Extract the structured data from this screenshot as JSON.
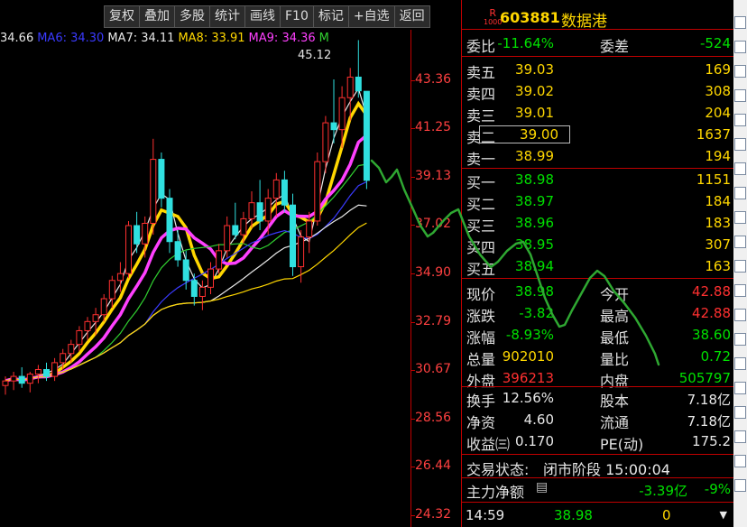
{
  "toolbar": {
    "buttons": [
      "复权",
      "叠加",
      "多股",
      "统计",
      "画线",
      "F10",
      "标记",
      "+自选",
      "返回"
    ]
  },
  "ma_legend": [
    {
      "label": "34.66",
      "color": "#e8e8e8"
    },
    {
      "label": "MA6: 34.30",
      "color": "#3a3aff"
    },
    {
      "label": "MA7: 34.11",
      "color": "#e8e8e8"
    },
    {
      "label": "MA8: 33.91",
      "color": "#ffd700"
    },
    {
      "label": "MA9: 34.36",
      "color": "#ff40ff"
    },
    {
      "label": "M",
      "color": "#30d030"
    }
  ],
  "peak_label": "45.12",
  "chart_data": {
    "type": "candlestick",
    "price_axis_ticks": [
      "43.36",
      "41.25",
      "39.13",
      "37.02",
      "34.90",
      "32.79",
      "30.67",
      "28.56",
      "26.44",
      "24.32"
    ],
    "ylim": [
      24.32,
      43.36
    ],
    "candles": [
      {
        "o": 30.0,
        "h": 30.4,
        "l": 29.6,
        "c": 30.2
      },
      {
        "o": 30.2,
        "h": 30.6,
        "l": 29.8,
        "c": 30.4
      },
      {
        "o": 30.4,
        "h": 30.8,
        "l": 29.9,
        "c": 30.1
      },
      {
        "o": 30.1,
        "h": 30.6,
        "l": 29.7,
        "c": 30.5
      },
      {
        "o": 30.5,
        "h": 30.9,
        "l": 30.1,
        "c": 30.7
      },
      {
        "o": 30.7,
        "h": 31.0,
        "l": 30.2,
        "c": 30.4
      },
      {
        "o": 30.4,
        "h": 31.2,
        "l": 30.2,
        "c": 31.0
      },
      {
        "o": 31.0,
        "h": 31.6,
        "l": 30.7,
        "c": 31.4
      },
      {
        "o": 31.4,
        "h": 32.0,
        "l": 31.0,
        "c": 31.8
      },
      {
        "o": 31.8,
        "h": 32.6,
        "l": 31.5,
        "c": 32.4
      },
      {
        "o": 32.4,
        "h": 33.0,
        "l": 32.0,
        "c": 32.8
      },
      {
        "o": 32.8,
        "h": 33.4,
        "l": 32.2,
        "c": 33.1
      },
      {
        "o": 33.1,
        "h": 34.0,
        "l": 32.8,
        "c": 33.8
      },
      {
        "o": 33.8,
        "h": 34.8,
        "l": 33.4,
        "c": 34.6
      },
      {
        "o": 34.6,
        "h": 35.4,
        "l": 34.1,
        "c": 34.9
      },
      {
        "o": 34.9,
        "h": 37.2,
        "l": 34.7,
        "c": 37.0
      },
      {
        "o": 37.0,
        "h": 37.6,
        "l": 35.8,
        "c": 36.2
      },
      {
        "o": 36.2,
        "h": 37.4,
        "l": 35.6,
        "c": 37.1
      },
      {
        "o": 37.1,
        "h": 40.8,
        "l": 36.6,
        "c": 39.9
      },
      {
        "o": 39.9,
        "h": 40.2,
        "l": 37.8,
        "c": 38.2
      },
      {
        "o": 38.2,
        "h": 38.6,
        "l": 35.8,
        "c": 36.3
      },
      {
        "o": 36.3,
        "h": 36.8,
        "l": 35.2,
        "c": 35.5
      },
      {
        "o": 35.5,
        "h": 35.9,
        "l": 34.2,
        "c": 34.6
      },
      {
        "o": 34.6,
        "h": 34.9,
        "l": 33.5,
        "c": 33.9
      },
      {
        "o": 33.9,
        "h": 34.6,
        "l": 33.3,
        "c": 34.3
      },
      {
        "o": 34.3,
        "h": 35.4,
        "l": 34.0,
        "c": 35.1
      },
      {
        "o": 35.1,
        "h": 36.2,
        "l": 34.9,
        "c": 35.9
      },
      {
        "o": 35.9,
        "h": 37.4,
        "l": 35.6,
        "c": 37.0
      },
      {
        "o": 37.0,
        "h": 38.0,
        "l": 36.4,
        "c": 36.6
      },
      {
        "o": 36.6,
        "h": 37.6,
        "l": 36.2,
        "c": 37.3
      },
      {
        "o": 37.3,
        "h": 38.5,
        "l": 36.9,
        "c": 38.0
      },
      {
        "o": 38.0,
        "h": 39.0,
        "l": 36.8,
        "c": 37.2
      },
      {
        "o": 37.2,
        "h": 38.6,
        "l": 36.6,
        "c": 38.2
      },
      {
        "o": 38.2,
        "h": 39.3,
        "l": 37.4,
        "c": 39.0
      },
      {
        "o": 39.0,
        "h": 39.4,
        "l": 37.6,
        "c": 37.9
      },
      {
        "o": 37.9,
        "h": 38.4,
        "l": 34.8,
        "c": 35.2
      },
      {
        "o": 35.2,
        "h": 36.8,
        "l": 34.5,
        "c": 36.5
      },
      {
        "o": 36.5,
        "h": 37.6,
        "l": 35.8,
        "c": 37.2
      },
      {
        "o": 37.2,
        "h": 40.2,
        "l": 37.0,
        "c": 39.8
      },
      {
        "o": 39.8,
        "h": 41.8,
        "l": 39.3,
        "c": 41.5
      },
      {
        "o": 41.5,
        "h": 43.4,
        "l": 40.6,
        "c": 41.2
      },
      {
        "o": 41.2,
        "h": 43.1,
        "l": 40.4,
        "c": 42.6
      },
      {
        "o": 42.6,
        "h": 43.9,
        "l": 41.6,
        "c": 43.5
      },
      {
        "o": 43.5,
        "h": 45.12,
        "l": 42.6,
        "c": 42.9
      },
      {
        "o": 42.88,
        "h": 42.88,
        "l": 38.6,
        "c": 38.98
      }
    ]
  },
  "quote": {
    "code": "603881",
    "name": "数据港",
    "r_badge": "R",
    "r_sub": "1000",
    "webi_label": "委比",
    "webi_value": "-11.64%",
    "weicha_label": "委差",
    "weicha_value": "-524",
    "asks": [
      {
        "label": "卖五",
        "price": "39.03",
        "vol": "169"
      },
      {
        "label": "卖四",
        "price": "39.02",
        "vol": "308"
      },
      {
        "label": "卖三",
        "price": "39.01",
        "vol": "204"
      },
      {
        "label": "卖二",
        "price": "39.00",
        "vol": "1637"
      },
      {
        "label": "卖一",
        "price": "38.99",
        "vol": "194"
      }
    ],
    "bids": [
      {
        "label": "买一",
        "price": "38.98",
        "vol": "1151"
      },
      {
        "label": "买二",
        "price": "38.97",
        "vol": "184"
      },
      {
        "label": "买三",
        "price": "38.96",
        "vol": "183"
      },
      {
        "label": "买四",
        "price": "38.95",
        "vol": "307"
      },
      {
        "label": "买五",
        "price": "38.94",
        "vol": "163"
      }
    ],
    "stats1": [
      {
        "l1": "现价",
        "v1": "38.98",
        "c1": "green",
        "l2": "今开",
        "v2": "42.88",
        "c2": "red"
      },
      {
        "l1": "涨跌",
        "v1": "-3.82",
        "c1": "green",
        "l2": "最高",
        "v2": "42.88",
        "c2": "red"
      },
      {
        "l1": "涨幅",
        "v1": "-8.93%",
        "c1": "green",
        "l2": "最低",
        "v2": "38.60",
        "c2": "green"
      },
      {
        "l1": "总量",
        "v1": "902010",
        "c1": "yellow",
        "l2": "量比",
        "v2": "0.72",
        "c2": "green"
      },
      {
        "l1": "外盘",
        "v1": "396213",
        "c1": "red",
        "l2": "内盘",
        "v2": "505797",
        "c2": "green"
      }
    ],
    "stats2": [
      {
        "l1": "换手",
        "v1": "12.56%",
        "l2": "股本",
        "v2": "7.18亿"
      },
      {
        "l1": "净资",
        "v1": "4.60",
        "l2": "流通",
        "v2": "7.18亿"
      },
      {
        "l1": "收益㈢",
        "v1": "0.170",
        "l2": "PE(动)",
        "v2": "175.2"
      }
    ],
    "trade_status_label": "交易状态:",
    "trade_status_value": "闭市阶段 15:00:04",
    "main_flow_label": "主力净额",
    "main_flow_value": "-3.39亿",
    "main_flow_pct": "-9%",
    "last_time": "14:59",
    "last_price": "38.98",
    "last_vol": "0"
  }
}
